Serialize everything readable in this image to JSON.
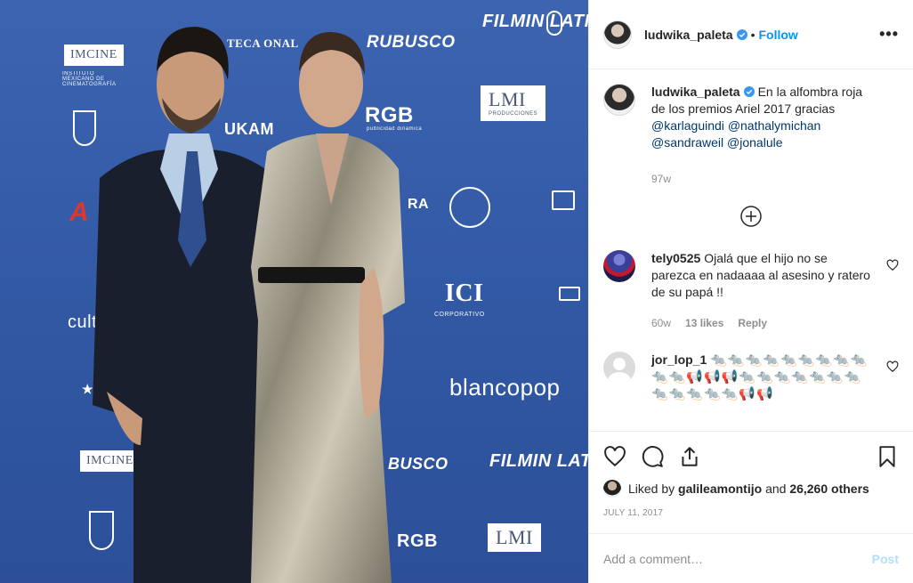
{
  "colors": {
    "accent": "#0095f6",
    "link": "#00376b",
    "muted": "#8e8e8e",
    "wall": "#335aa6"
  },
  "backdrop_logos": {
    "filmin_top": "FILMIN LATINO",
    "imcine_top": "IMCINE",
    "imcine_top_sub": "INSTITUTO MEXICANO DE CINEMATOGRAFÍA",
    "cineteca": "TECA ONAL",
    "churubusco_top": "RUBUSCO",
    "unam": "UKAM",
    "rgb": "RGB",
    "rgb_sub": "publicidad dinámica",
    "lmi_top": "LMI",
    "lmi_sub": "PRODUCCIONES",
    "ra": "RA",
    "ici": "ICI",
    "ici_sub": "CORPORATIVO",
    "cult": "cult",
    "blancopop": "blancopop",
    "imcine_bottom": "IMCINE",
    "churubusco_bottom": "BUSCO",
    "filmin_bottom": "FILMIN LATINO",
    "rgb_bottom": "RGB",
    "lmi_bottom": "LMI"
  },
  "header": {
    "username": "ludwika_paleta",
    "separator": "•",
    "follow_label": "Follow",
    "more_icon": "more-dots-icon",
    "more_label": "•••"
  },
  "caption": {
    "username": "ludwika_paleta",
    "text": "En la alfombra roja de los premios Ariel 2017 gracias",
    "mentions": [
      "@karlaguindi",
      "@nathalymichan",
      "@sandraweil",
      "@jonalule"
    ],
    "time": "97w"
  },
  "load_more_icon": "plus-circle-icon",
  "comments": [
    {
      "username": "tely0525",
      "text": "Ojalá que el hijo no se parezca en nadaaaa al asesino y ratero de su papá !!",
      "time": "60w",
      "likes": "13 likes",
      "reply": "Reply"
    },
    {
      "username": "jor_lop_1",
      "text": "🐀🐀🐀🐀🐀🐀🐀🐀🐀🐀🐀📢📢📢🐀🐀🐀🐀🐀🐀🐀🐀🐀🐀🐀🐀📢📢"
    }
  ],
  "actions": {
    "like_icon": "heart-icon",
    "comment_icon": "comment-icon",
    "share_icon": "share-icon",
    "save_icon": "bookmark-icon"
  },
  "likes": {
    "prefix": "Liked by",
    "user": "galileamontijo",
    "middle": "and",
    "others": "26,260 others"
  },
  "date": "JULY 11, 2017",
  "add_comment": {
    "placeholder": "Add a comment…",
    "post_label": "Post"
  }
}
